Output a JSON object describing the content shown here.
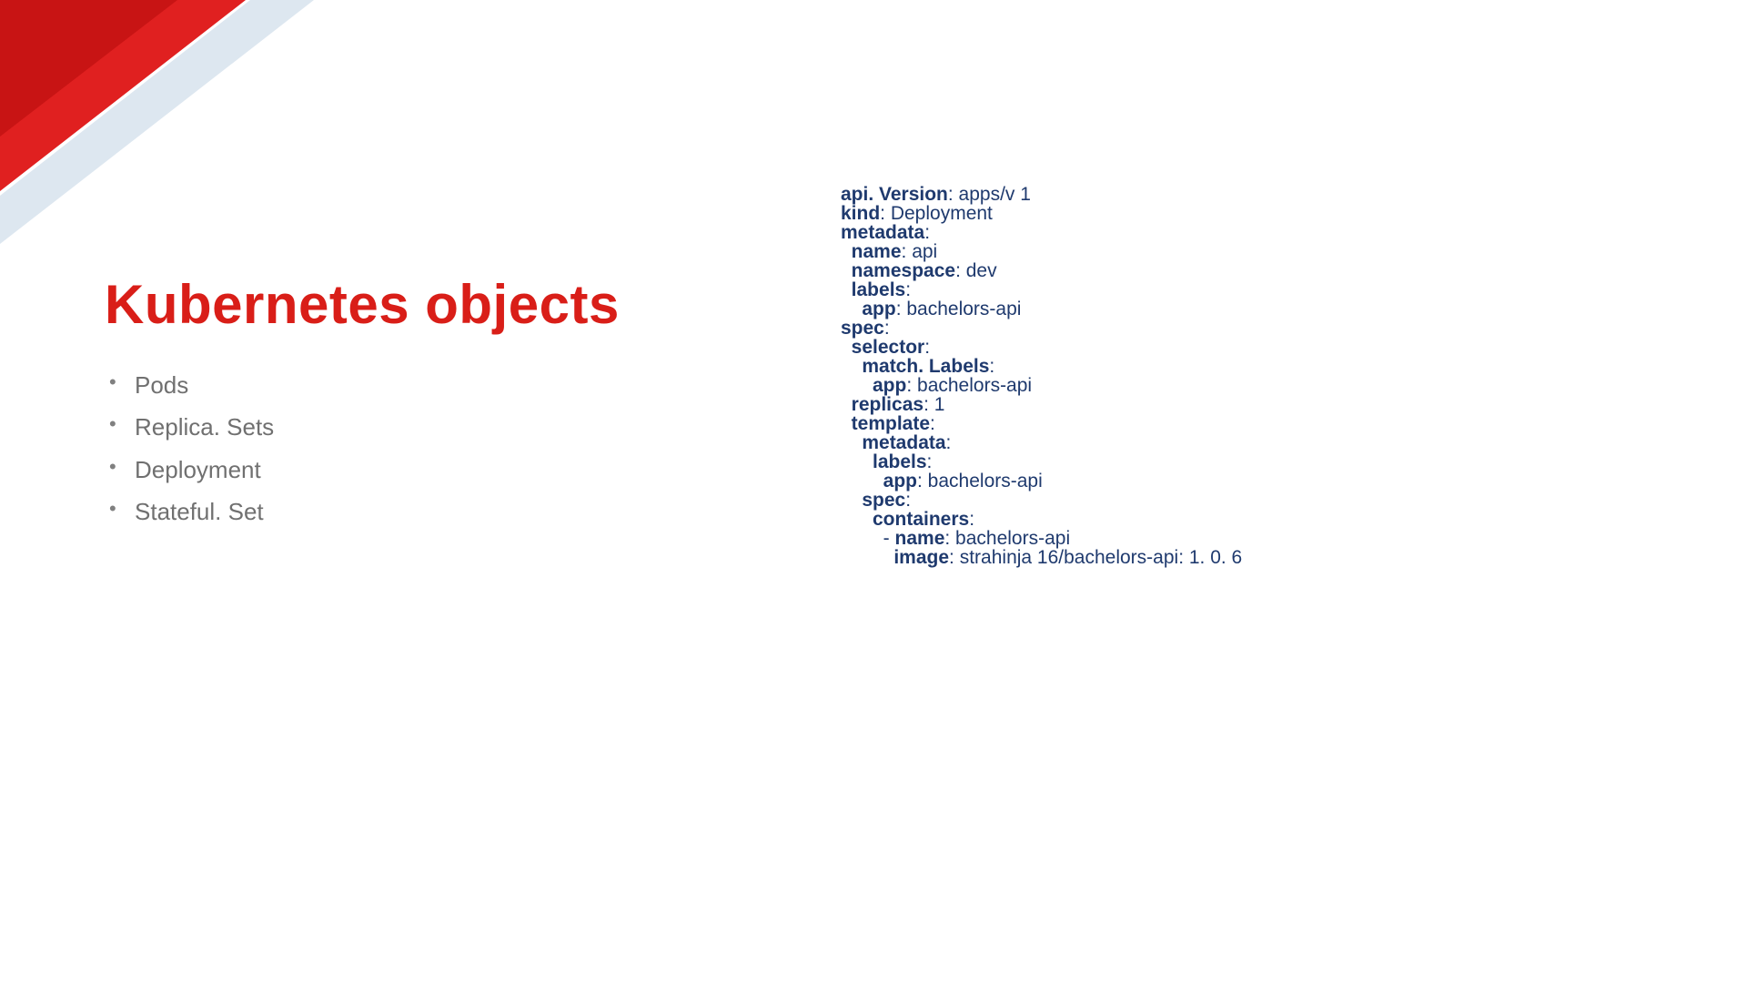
{
  "title": "Kubernetes objects",
  "bullets": {
    "b0": "Pods",
    "b1": "Replica. Sets",
    "b2": "Deployment",
    "b3": "Stateful. Set"
  },
  "yaml": {
    "l0k": "api. Version",
    "l0v": ": apps/v 1",
    "l1k": "kind",
    "l1v": ": Deployment",
    "l2k": "metadata",
    "l2v": ":",
    "l3k": "  name",
    "l3v": ": api",
    "l4k": "  namespace",
    "l4v": ": dev",
    "l5k": "  labels",
    "l5v": ":",
    "l6k": "    app",
    "l6v": ": bachelors-api",
    "l7k": "spec",
    "l7v": ":",
    "l8k": "  selector",
    "l8v": ":",
    "l9k": "    match. Labels",
    "l9v": ":",
    "l10k": "      app",
    "l10v": ": bachelors-api",
    "l11k": "  replicas",
    "l11v": ": 1",
    "l12k": "  template",
    "l12v": ":",
    "l13k": "    metadata",
    "l13v": ":",
    "l14k": "      labels",
    "l14v": ":",
    "l15k": "        app",
    "l15v": ": bachelors-api",
    "l16k": "    spec",
    "l16v": ":",
    "l17k": "      containers",
    "l17v": ":",
    "l18d": "        - ",
    "l18k": "name",
    "l18v": ": bachelors-api",
    "l19k": "          image",
    "l19v": ": strahinja 16/bachelors-api: 1. 0. 6"
  }
}
